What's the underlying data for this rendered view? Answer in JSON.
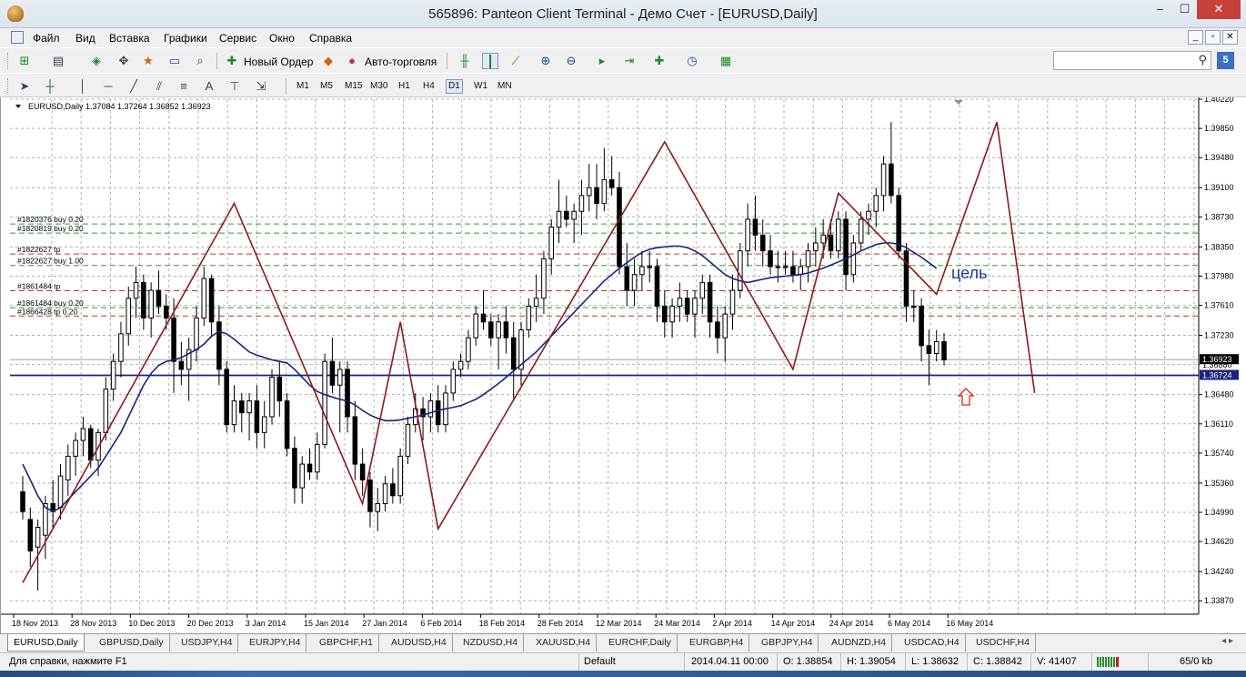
{
  "window": {
    "title": "565896: Panteon Client Terminal - Демо Счет - [EURUSD,Daily]",
    "min_glyph": "–",
    "max_glyph": "☐",
    "close_glyph": "✕"
  },
  "menu": {
    "items": [
      "Файл",
      "Вид",
      "Вставка",
      "Графики",
      "Сервис",
      "Окно",
      "Справка"
    ],
    "mdi_buttons": [
      "_",
      "▫",
      "✕"
    ]
  },
  "toolbar": {
    "new_order_label": "Новый Ордер",
    "autotrading_label": "Авто-торговля",
    "search_placeholder": "",
    "help_label": "5",
    "timeframes": [
      "M1",
      "M5",
      "M15",
      "M30",
      "H1",
      "H4",
      "D1",
      "W1",
      "MN"
    ],
    "active_timeframe": "D1",
    "draw_tools_text": "A"
  },
  "chart": {
    "header_text": "EURUSD,Daily  1.37084 1.37264 1.36852 1.36923",
    "annotation_text": "цель",
    "annotation_color": "#1c3a9c",
    "current_price_label": "1.36923",
    "hline_price_label": "1.36724",
    "hidden_price_label": "1.36880",
    "price_levels": [
      "1.40220",
      "1.39850",
      "1.39480",
      "1.39100",
      "1.38730",
      "1.38350",
      "1.37980",
      "1.37610",
      "1.37230",
      "1.36860",
      "1.36480",
      "1.36110",
      "1.35740",
      "1.35360",
      "1.34990",
      "1.34620",
      "1.34240",
      "1.33870"
    ],
    "date_labels": [
      "18 Nov 2013",
      "28 Nov 2013",
      "10 Dec 2013",
      "20 Dec 2013",
      "3 Jan 2014",
      "15 Jan 2014",
      "27 Jan 2014",
      "6 Feb 2014",
      "18 Feb 2014",
      "28 Feb 2014",
      "12 Mar 2014",
      "24 Mar 2014",
      "2 Apr 2014",
      "14 Apr 2014",
      "24 Apr 2014",
      "6 May 2014",
      "16 May 2014"
    ],
    "order_lines": [
      {
        "label": "#1820376 buy 0.20",
        "price": 1.3864,
        "color": "#2e9a2e"
      },
      {
        "label": "#1820819 buy 0.20",
        "price": 1.38525,
        "color": "#2e9a2e"
      },
      {
        "label": "#1822627 tp",
        "price": 1.3826,
        "color": "#c03030"
      },
      {
        "label": "#1822627 buy 1.00",
        "price": 1.38115,
        "color": "#2e9a2e"
      },
      {
        "label": "#1861484 tp",
        "price": 1.37795,
        "color": "#c03030"
      },
      {
        "label": "#1861484 buy 0.20",
        "price": 1.3758,
        "color": "#2e9a2e"
      },
      {
        "label": "#1866428 tp 0.20",
        "price": 1.37475,
        "color": "#c03030"
      }
    ],
    "horizontal_line_color": "#1a237e",
    "zigzag_color": "#8b1a1a",
    "ma_color": "#1a237e"
  },
  "chart_data": {
    "type": "candlestick",
    "symbol": "EURUSD",
    "timeframe": "Daily",
    "ylim": [
      1.337,
      1.4022
    ],
    "current_ohlc": {
      "open": 1.37084,
      "high": 1.37264,
      "low": 1.36852,
      "close": 1.36923
    },
    "horizontal_line": 1.36724,
    "candles": [
      [
        1.3525,
        1.3545,
        1.349,
        1.35
      ],
      [
        1.349,
        1.3505,
        1.343,
        1.345
      ],
      [
        1.3455,
        1.349,
        1.34,
        1.348
      ],
      [
        1.347,
        1.352,
        1.344,
        1.351
      ],
      [
        1.351,
        1.354,
        1.348,
        1.35
      ],
      [
        1.3505,
        1.356,
        1.349,
        1.3545
      ],
      [
        1.354,
        1.3585,
        1.352,
        1.357
      ],
      [
        1.357,
        1.36,
        1.3545,
        1.359
      ],
      [
        1.359,
        1.362,
        1.357,
        1.3605
      ],
      [
        1.3605,
        1.361,
        1.3555,
        1.3565
      ],
      [
        1.3565,
        1.3605,
        1.3545,
        1.36
      ],
      [
        1.36,
        1.367,
        1.359,
        1.3655
      ],
      [
        1.3655,
        1.37,
        1.364,
        1.369
      ],
      [
        1.369,
        1.374,
        1.367,
        1.3725
      ],
      [
        1.3725,
        1.3785,
        1.371,
        1.377
      ],
      [
        1.377,
        1.381,
        1.3745,
        1.379
      ],
      [
        1.379,
        1.38,
        1.373,
        1.3745
      ],
      [
        1.3745,
        1.379,
        1.372,
        1.378
      ],
      [
        1.378,
        1.3805,
        1.375,
        1.376
      ],
      [
        1.376,
        1.3775,
        1.373,
        1.3745
      ],
      [
        1.3745,
        1.377,
        1.365,
        1.369
      ],
      [
        1.369,
        1.3715,
        1.366,
        1.368
      ],
      [
        1.368,
        1.372,
        1.364,
        1.3705
      ],
      [
        1.3705,
        1.376,
        1.369,
        1.3745
      ],
      [
        1.3745,
        1.381,
        1.3735,
        1.3795
      ],
      [
        1.3795,
        1.38,
        1.372,
        1.374
      ],
      [
        1.374,
        1.376,
        1.366,
        1.368
      ],
      [
        1.368,
        1.369,
        1.36,
        1.361
      ],
      [
        1.361,
        1.366,
        1.36,
        1.364
      ],
      [
        1.364,
        1.365,
        1.36,
        1.3625
      ],
      [
        1.3625,
        1.365,
        1.359,
        1.364
      ],
      [
        1.364,
        1.366,
        1.358,
        1.36
      ],
      [
        1.36,
        1.364,
        1.358,
        1.362
      ],
      [
        1.362,
        1.368,
        1.361,
        1.367
      ],
      [
        1.367,
        1.369,
        1.362,
        1.364
      ],
      [
        1.364,
        1.365,
        1.357,
        1.358
      ],
      [
        1.358,
        1.3595,
        1.351,
        1.353
      ],
      [
        1.353,
        1.357,
        1.351,
        1.356
      ],
      [
        1.356,
        1.358,
        1.354,
        1.355
      ],
      [
        1.355,
        1.36,
        1.354,
        1.3585
      ],
      [
        1.3585,
        1.37,
        1.358,
        1.369
      ],
      [
        1.369,
        1.372,
        1.365,
        1.366
      ],
      [
        1.366,
        1.369,
        1.36,
        1.368
      ],
      [
        1.368,
        1.369,
        1.36,
        1.362
      ],
      [
        1.362,
        1.364,
        1.354,
        1.356
      ],
      [
        1.356,
        1.358,
        1.352,
        1.354
      ],
      [
        1.354,
        1.355,
        1.348,
        1.35
      ],
      [
        1.35,
        1.353,
        1.3475,
        1.351
      ],
      [
        1.351,
        1.3545,
        1.35,
        1.3535
      ],
      [
        1.3535,
        1.3555,
        1.351,
        1.352
      ],
      [
        1.352,
        1.358,
        1.351,
        1.357
      ],
      [
        1.357,
        1.362,
        1.356,
        1.361
      ],
      [
        1.361,
        1.365,
        1.36,
        1.363
      ],
      [
        1.363,
        1.3645,
        1.359,
        1.362
      ],
      [
        1.362,
        1.365,
        1.36,
        1.364
      ],
      [
        1.364,
        1.366,
        1.36,
        1.361
      ],
      [
        1.361,
        1.366,
        1.36,
        1.365
      ],
      [
        1.365,
        1.369,
        1.364,
        1.368
      ],
      [
        1.368,
        1.37,
        1.367,
        1.369
      ],
      [
        1.369,
        1.373,
        1.368,
        1.372
      ],
      [
        1.372,
        1.376,
        1.371,
        1.375
      ],
      [
        1.375,
        1.378,
        1.373,
        1.374
      ],
      [
        1.374,
        1.375,
        1.371,
        1.372
      ],
      [
        1.372,
        1.375,
        1.368,
        1.374
      ],
      [
        1.374,
        1.376,
        1.37,
        1.372
      ],
      [
        1.372,
        1.374,
        1.364,
        1.368
      ],
      [
        1.368,
        1.374,
        1.366,
        1.373
      ],
      [
        1.373,
        1.377,
        1.372,
        1.376
      ],
      [
        1.376,
        1.38,
        1.374,
        1.377
      ],
      [
        1.377,
        1.383,
        1.375,
        1.382
      ],
      [
        1.382,
        1.387,
        1.38,
        1.386
      ],
      [
        1.386,
        1.392,
        1.384,
        1.388
      ],
      [
        1.388,
        1.39,
        1.386,
        1.387
      ],
      [
        1.387,
        1.389,
        1.384,
        1.388
      ],
      [
        1.388,
        1.392,
        1.385,
        1.39
      ],
      [
        1.39,
        1.394,
        1.388,
        1.391
      ],
      [
        1.391,
        1.394,
        1.387,
        1.389
      ],
      [
        1.389,
        1.396,
        1.388,
        1.392
      ],
      [
        1.392,
        1.395,
        1.39,
        1.391
      ],
      [
        1.391,
        1.393,
        1.38,
        1.381
      ],
      [
        1.381,
        1.384,
        1.376,
        1.378
      ],
      [
        1.378,
        1.382,
        1.376,
        1.38
      ],
      [
        1.38,
        1.383,
        1.378,
        1.381
      ],
      [
        1.381,
        1.383,
        1.379,
        1.381
      ],
      [
        1.381,
        1.382,
        1.374,
        1.376
      ],
      [
        1.376,
        1.378,
        1.372,
        1.374
      ],
      [
        1.374,
        1.377,
        1.372,
        1.376
      ],
      [
        1.376,
        1.379,
        1.374,
        1.377
      ],
      [
        1.377,
        1.378,
        1.374,
        1.375
      ],
      [
        1.375,
        1.378,
        1.372,
        1.377
      ],
      [
        1.377,
        1.38,
        1.375,
        1.379
      ],
      [
        1.379,
        1.38,
        1.372,
        1.374
      ],
      [
        1.374,
        1.376,
        1.37,
        1.372
      ],
      [
        1.372,
        1.376,
        1.369,
        1.375
      ],
      [
        1.375,
        1.38,
        1.373,
        1.378
      ],
      [
        1.378,
        1.384,
        1.377,
        1.383
      ],
      [
        1.383,
        1.389,
        1.381,
        1.387
      ],
      [
        1.387,
        1.39,
        1.383,
        1.385
      ],
      [
        1.385,
        1.387,
        1.381,
        1.383
      ],
      [
        1.383,
        1.385,
        1.38,
        1.381
      ],
      [
        1.381,
        1.383,
        1.379,
        1.381
      ],
      [
        1.381,
        1.383,
        1.38,
        1.381
      ],
      [
        1.381,
        1.383,
        1.379,
        1.38
      ],
      [
        1.38,
        1.382,
        1.378,
        1.381
      ],
      [
        1.381,
        1.384,
        1.379,
        1.383
      ],
      [
        1.383,
        1.386,
        1.381,
        1.384
      ],
      [
        1.384,
        1.387,
        1.382,
        1.385
      ],
      [
        1.385,
        1.387,
        1.382,
        1.383
      ],
      [
        1.383,
        1.388,
        1.382,
        1.387
      ],
      [
        1.387,
        1.388,
        1.378,
        1.38
      ],
      [
        1.38,
        1.385,
        1.379,
        1.384
      ],
      [
        1.384,
        1.388,
        1.383,
        1.387
      ],
      [
        1.387,
        1.389,
        1.385,
        1.388
      ],
      [
        1.388,
        1.391,
        1.386,
        1.39
      ],
      [
        1.39,
        1.395,
        1.388,
        1.394
      ],
      [
        1.394,
        1.3993,
        1.389,
        1.39
      ],
      [
        1.39,
        1.391,
        1.382,
        1.383
      ],
      [
        1.383,
        1.384,
        1.374,
        1.376
      ],
      [
        1.376,
        1.378,
        1.374,
        1.376
      ],
      [
        1.376,
        1.377,
        1.369,
        1.371
      ],
      [
        1.371,
        1.373,
        1.366,
        1.37
      ],
      [
        1.37,
        1.373,
        1.369,
        1.3715
      ],
      [
        1.3715,
        1.3726,
        1.3685,
        1.3692
      ]
    ],
    "series": [
      {
        "name": "MA",
        "values": [
          1.356,
          1.354,
          1.352,
          1.3505,
          1.35,
          1.3505,
          1.3515,
          1.3525,
          1.3535,
          1.3545,
          1.3555,
          1.357,
          1.3585,
          1.36,
          1.362,
          1.364,
          1.366,
          1.3675,
          1.3685,
          1.369,
          1.3692,
          1.3695,
          1.37,
          1.3705,
          1.3712,
          1.3722,
          1.3728,
          1.3725,
          1.3718,
          1.371,
          1.3702,
          1.3698,
          1.3695,
          1.3692,
          1.369,
          1.3688,
          1.368,
          1.367,
          1.366,
          1.3652,
          1.3648,
          1.3645,
          1.3642,
          1.364,
          1.3635,
          1.3628,
          1.3622,
          1.3618,
          1.3615,
          1.3615,
          1.3616,
          1.3618,
          1.362,
          1.3622,
          1.3625,
          1.3628,
          1.363,
          1.3632,
          1.3634,
          1.3638,
          1.3642,
          1.3648,
          1.3655,
          1.3662,
          1.367,
          1.3678,
          1.3686,
          1.3694,
          1.3702,
          1.3712,
          1.3722,
          1.3732,
          1.3742,
          1.3752,
          1.3762,
          1.3772,
          1.3782,
          1.3792,
          1.38,
          1.3808,
          1.3815,
          1.3822,
          1.3828,
          1.3832,
          1.3834,
          1.3835,
          1.3836,
          1.3836,
          1.3834,
          1.383,
          1.3824,
          1.3816,
          1.3808,
          1.38,
          1.3795,
          1.3792,
          1.379,
          1.3792,
          1.3794,
          1.3796,
          1.3797,
          1.3798,
          1.3799,
          1.38,
          1.3802,
          1.3805,
          1.3808,
          1.3812,
          1.3816,
          1.382,
          1.3825,
          1.383,
          1.3834,
          1.3838,
          1.384,
          1.384,
          1.3838,
          1.3834,
          1.3828,
          1.3822,
          1.3815,
          1.3808
        ]
      },
      {
        "name": "ZigZag",
        "points": [
          [
            0,
            1.341
          ],
          [
            28,
            1.389
          ],
          [
            45,
            1.351
          ],
          [
            50,
            1.374
          ],
          [
            55,
            1.3478
          ],
          [
            85,
            1.3968
          ],
          [
            102,
            1.368
          ],
          [
            108,
            1.3903
          ],
          [
            121,
            1.3775
          ],
          [
            129,
            1.3993
          ],
          [
            134,
            1.365
          ]
        ]
      }
    ]
  },
  "tabs": [
    "EURUSD,Daily",
    "GBPUSD,Daily",
    "USDJPY,H4",
    "EURJPY,H4",
    "GBPCHF,H1",
    "AUDUSD,H4",
    "NZDUSD,H4",
    "XAUUSD,H4",
    "EURCHF,Daily",
    "EURGBP,H4",
    "GBPJPY,H4",
    "AUDNZD,H4",
    "USDCAD,H4",
    "USDCHF,H4"
  ],
  "active_tab": "EURUSD,Daily",
  "status": {
    "help_text": "Для справки, нажмите F1",
    "profile": "Default",
    "datetime": "2014.04.11 00:00",
    "open": "O: 1.38854",
    "high": "H: 1.39054",
    "low": "L: 1.38632",
    "close": "C: 1.38842",
    "volume": "V: 41407",
    "traffic": "65/0 kb"
  }
}
